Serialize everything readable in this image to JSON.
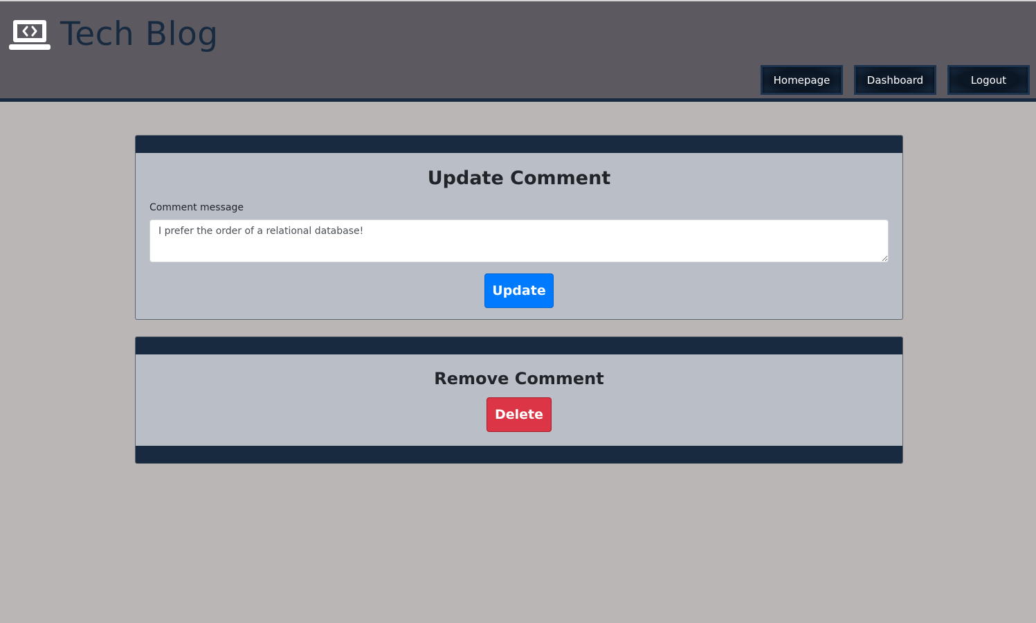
{
  "header": {
    "title": "Tech Blog",
    "icon": "laptop-code-icon",
    "nav": {
      "homepage": "Homepage",
      "dashboard": "Dashboard",
      "logout": "Logout"
    }
  },
  "update_card": {
    "title": "Update Comment",
    "field_label": "Comment message",
    "comment_value": "I prefer the order of a relational database!",
    "button": "Update"
  },
  "remove_card": {
    "title": "Remove Comment",
    "button": "Delete"
  },
  "colors": {
    "header_bg": "#5c5960",
    "navy": "#172a40",
    "page_bg": "#bab6b5",
    "card_bg": "#b9bec7",
    "primary": "#007bff",
    "danger": "#dc3545"
  }
}
